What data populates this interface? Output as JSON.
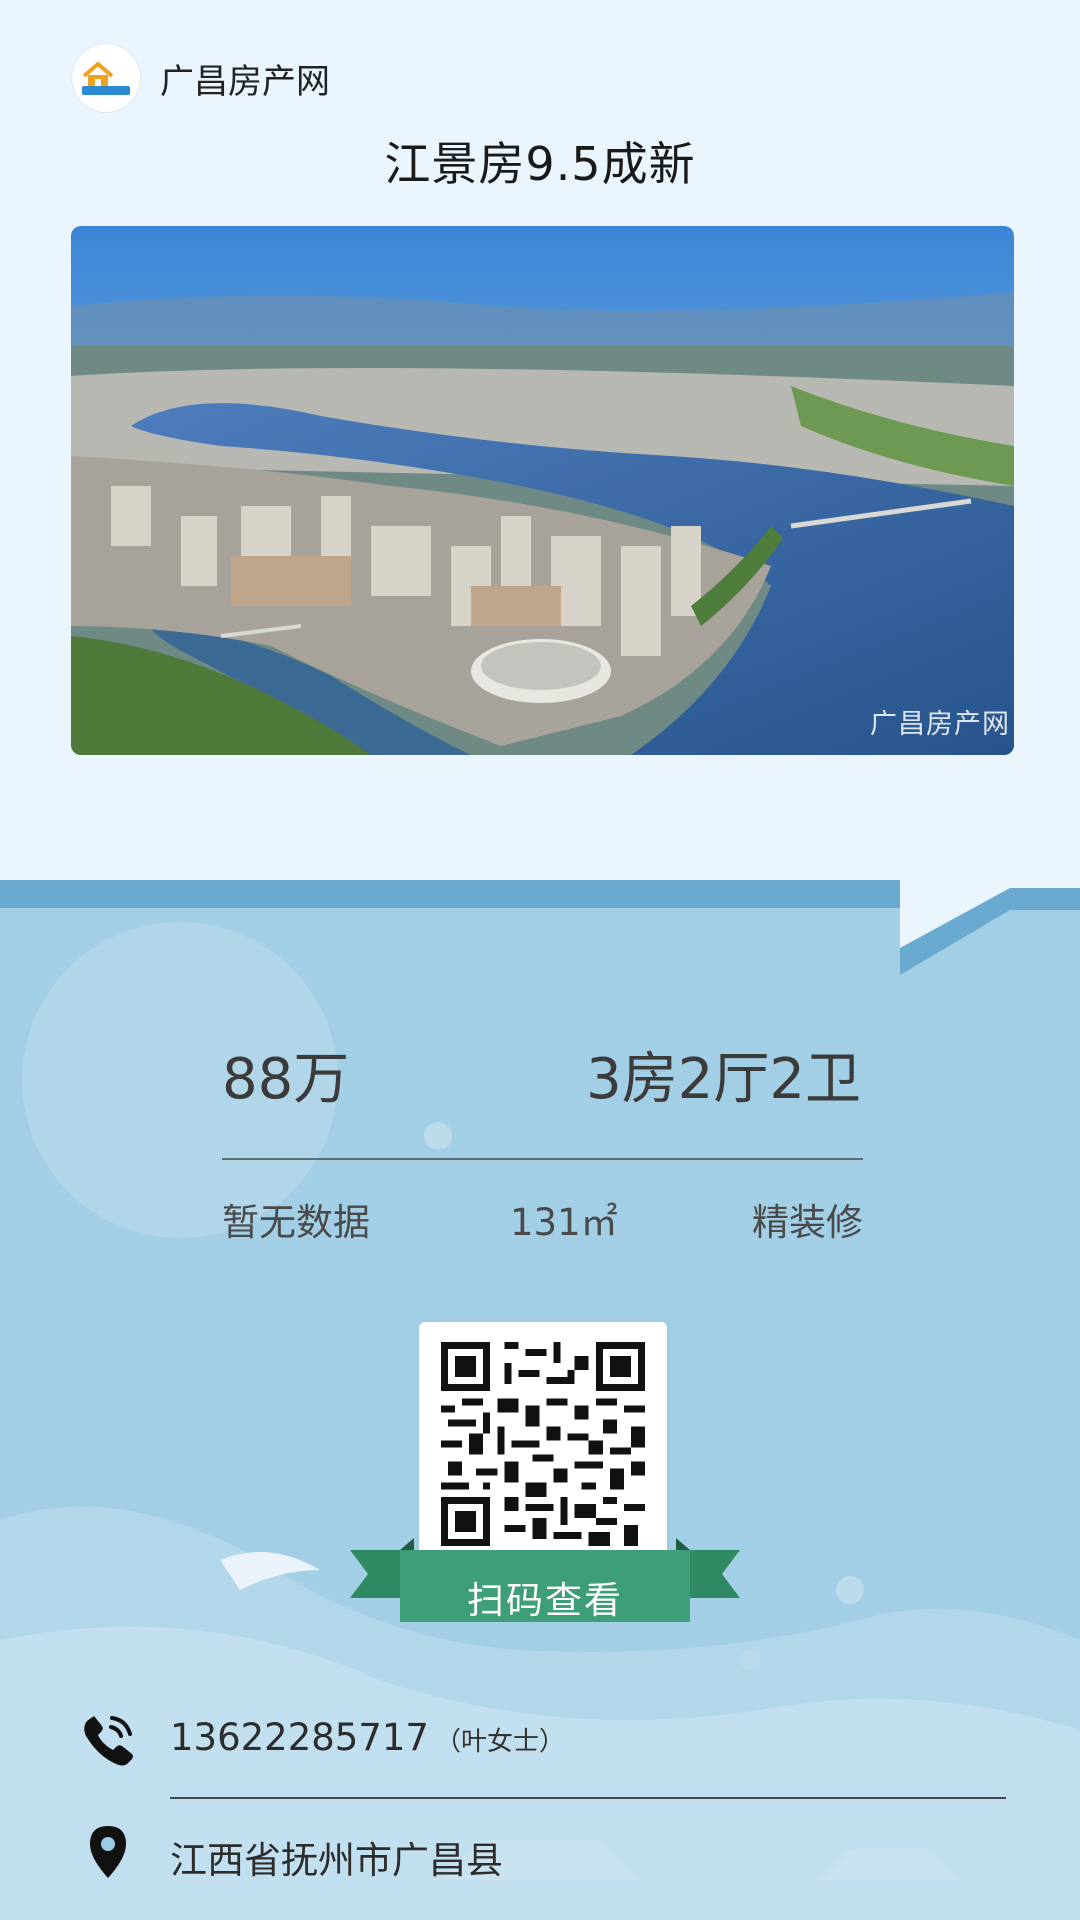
{
  "header": {
    "brand_name": "广昌房产网",
    "logo_text": "广昌房产网",
    "title": "江景房9.5成新"
  },
  "photo": {
    "watermark": "广昌房产网"
  },
  "listing": {
    "price": "88万",
    "layout": "3房2厅2卫",
    "orientation": "暂无数据",
    "area": "131㎡",
    "decoration": "精装修"
  },
  "qr": {
    "label": "扫码查看"
  },
  "contact": {
    "phone": "13622285717",
    "contact_name": "（叶女士）",
    "address": "江西省抚州市广昌县"
  },
  "icons": {
    "phone": "phone-icon",
    "location": "location-pin-icon"
  },
  "colors": {
    "page_bg": "#eaf5fd",
    "card_bg": "#99c9e2",
    "ribbon_green": "#3d9e78",
    "ribbon_dark": "#2a7052"
  }
}
